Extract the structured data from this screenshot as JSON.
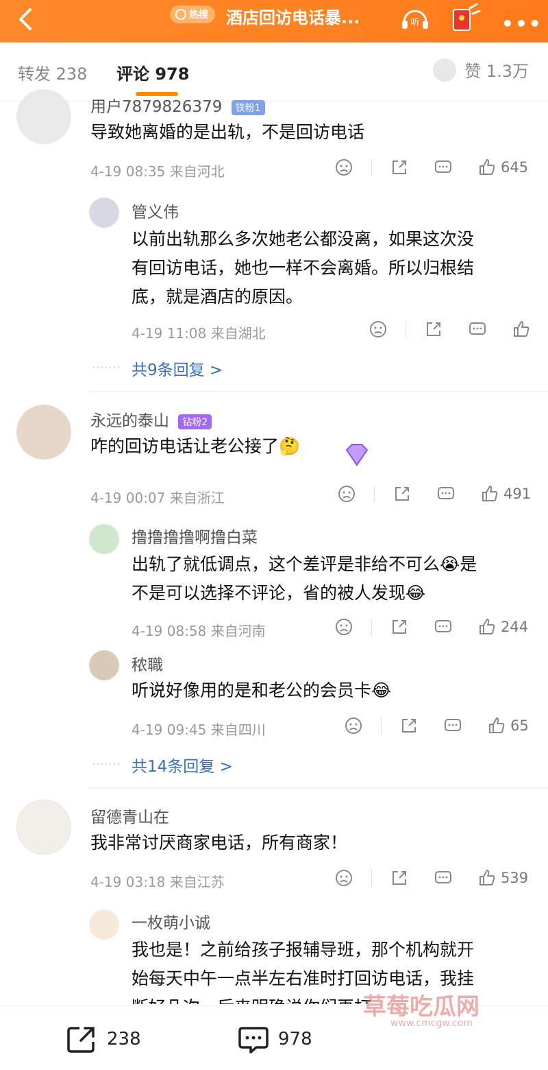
{
  "header": {
    "hot_label": "热搜",
    "title": "酒店回访电话暴..."
  },
  "tabs": {
    "repost": "转发 238",
    "comments": "评论 978",
    "likes": "赞 1.3万"
  },
  "comments": [
    {
      "user": "用户7879826379",
      "badge": "铁粉1",
      "text": "导致她离婚的是出轨，不是回访电话",
      "meta": "4-19 08:35 来自河北",
      "likes": "645",
      "replies": [
        {
          "user": "管义伟",
          "text_lines": [
            "以前出轨那么多次她老公都没离，如果这次没",
            "有回访电话，她也一样不会离婚。所以归根结",
            "底，就是酒店的原因。"
          ],
          "meta": "4-19 11:08 来自湖北",
          "likes": ""
        }
      ],
      "more_replies": "共9条回复 >"
    },
    {
      "user": "永远的泰山",
      "badge": "钻粉2",
      "text": "咋的回访电话让老公接了🤔",
      "meta": "4-19 00:07 来自浙江",
      "likes": "491",
      "replies": [
        {
          "user": "撸撸撸撸啊撸白菜",
          "text_lines": [
            "出轨了就低调点，这个差评是非给不可么😭是",
            "不是可以选择不评论，省的被人发现😂"
          ],
          "meta": "4-19 08:58 来自河南",
          "likes": "244"
        },
        {
          "user": "秾職",
          "text_lines": [
            "听说好像用的是和老公的会员卡😂"
          ],
          "meta": "4-19 09:45 来自四川",
          "likes": "65"
        }
      ],
      "more_replies": "共14条回复 >"
    },
    {
      "user": "留德青山在",
      "text": "我非常讨厌商家电话，所有商家！",
      "meta": "4-19 03:18 来自江苏",
      "likes": "539",
      "replies": [
        {
          "user": "一枚萌小诚",
          "text_lines": [
            "我也是！之前给孩子报辅导班，那个机构就开",
            "始每天中午一点半左右准时打回访电话，我挂",
            "断好几次，后来明确说你们再打"
          ]
        }
      ]
    }
  ],
  "bottom": {
    "repost_count": "238",
    "comment_count": "978"
  },
  "watermark": {
    "line1": "草莓吃瓜网",
    "line2": "www.cmcgw.com"
  },
  "colors": {
    "header_orange": "#ff7a1a",
    "tab_underline": "#ff8a00",
    "link_blue": "#3a6fb7"
  }
}
